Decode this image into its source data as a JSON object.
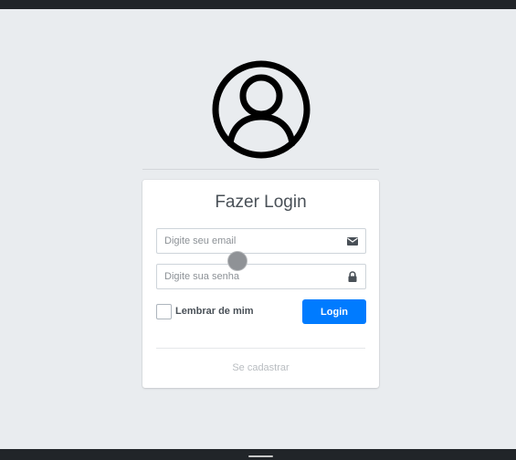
{
  "login_card": {
    "title": "Fazer Login",
    "email_placeholder": "Digite seu email",
    "password_placeholder": "Digite sua senha",
    "remember_label": "Lembrar de mim",
    "remember_checked": false,
    "login_label": "Login",
    "register_link": "Se cadastrar"
  },
  "icons": {
    "avatar": "user-circle-icon",
    "email": "envelope-icon",
    "password": "lock-icon"
  },
  "colors": {
    "background": "#e9ecef",
    "primary": "#007bff",
    "text": "#495057",
    "muted": "#b9bdc1"
  }
}
